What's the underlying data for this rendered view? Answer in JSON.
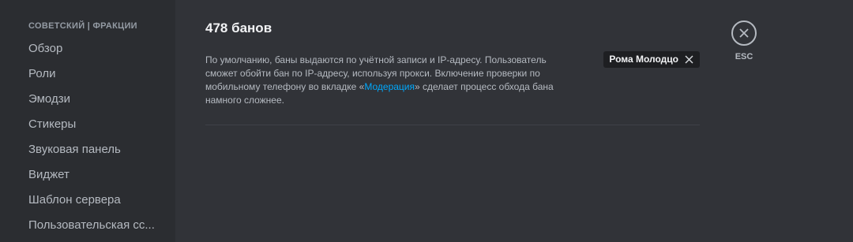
{
  "sidebar": {
    "header": "СОВЕТСКИЙ | ФРАКЦИИ",
    "items": [
      {
        "label": "Обзор"
      },
      {
        "label": "Роли"
      },
      {
        "label": "Эмодзи"
      },
      {
        "label": "Стикеры"
      },
      {
        "label": "Звуковая панель"
      },
      {
        "label": "Виджет"
      },
      {
        "label": "Шаблон сервера"
      },
      {
        "label": "Пользовательская сс..."
      }
    ]
  },
  "main": {
    "title": "478 банов",
    "description_part1": "По умолчанию, баны выдаются по учётной записи и IP-адресу. Пользователь сможет обойти бан по IP-адресу, используя прокси. Включение проверки по мобильному телефону во вкладке «",
    "description_link": "Модерация",
    "description_part2": "» сделает процесс обхода бана намного сложнее.",
    "user_chip": "Рома Молодцо",
    "close_label": "ESC"
  },
  "colors": {
    "background": "#313338",
    "sidebar": "#2b2d31",
    "link": "#00a8fc",
    "chip": "#1e1f22"
  }
}
